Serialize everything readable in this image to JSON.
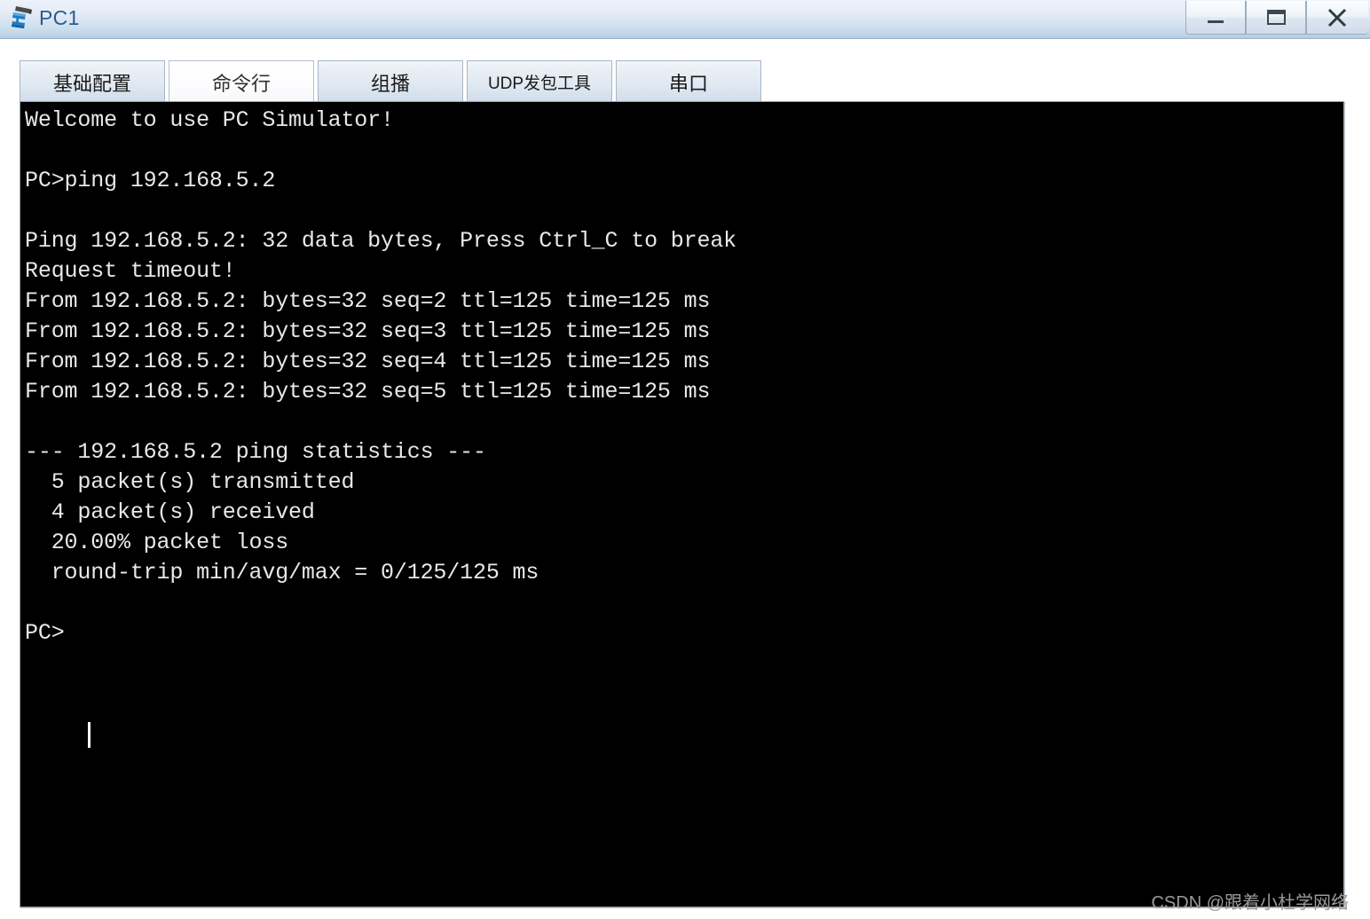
{
  "window": {
    "title": "PC1",
    "icon": "pc-device-icon",
    "controls": [
      {
        "name": "minimize-button",
        "label": "_",
        "icon": "minimize-icon"
      },
      {
        "name": "maximize-button",
        "label": "□",
        "icon": "maximize-icon"
      },
      {
        "name": "close-button",
        "label": "X",
        "icon": "close-icon"
      }
    ],
    "title_color": "#2b5b8e",
    "titlebar_gradient_top": "#eef2fa",
    "titlebar_gradient_bottom": "#b4cbe0"
  },
  "tabs": [
    {
      "label": "基础配置",
      "name": "tab-basic-config",
      "active": false
    },
    {
      "label": "命令行",
      "name": "tab-command-line",
      "active": true
    },
    {
      "label": "组播",
      "name": "tab-multicast",
      "active": false
    },
    {
      "label": "UDP发包工具",
      "name": "tab-udp-packet-tool",
      "active": false
    },
    {
      "label": "串口",
      "name": "tab-serial-port",
      "active": false
    }
  ],
  "terminal": {
    "background": "#000000",
    "foreground": "#e8e8e8",
    "prompt": "PC>",
    "command": "ping 192.168.5.2",
    "target_ip": "192.168.5.2",
    "cursor_visible": true,
    "lines": [
      "Welcome to use PC Simulator!",
      "",
      "PC>ping 192.168.5.2",
      "",
      "Ping 192.168.5.2: 32 data bytes, Press Ctrl_C to break",
      "Request timeout!",
      "From 192.168.5.2: bytes=32 seq=2 ttl=125 time=125 ms",
      "From 192.168.5.2: bytes=32 seq=3 ttl=125 time=125 ms",
      "From 192.168.5.2: bytes=32 seq=4 ttl=125 time=125 ms",
      "From 192.168.5.2: bytes=32 seq=5 ttl=125 time=125 ms",
      "",
      "--- 192.168.5.2 ping statistics ---",
      "  5 packet(s) transmitted",
      "  4 packet(s) received",
      "  20.00% packet loss",
      "  round-trip min/avg/max = 0/125/125 ms",
      "",
      "PC>"
    ],
    "statistics": {
      "header": "--- 192.168.5.2 ping statistics ---",
      "transmitted": "5 packet(s) transmitted",
      "received": "4 packet(s) received",
      "packet_loss": "20.00% packet loss",
      "round_trip": "round-trip min/avg/max = 0/125/125 ms"
    }
  },
  "watermark": {
    "text": "CSDN @跟着小杜学网络"
  }
}
